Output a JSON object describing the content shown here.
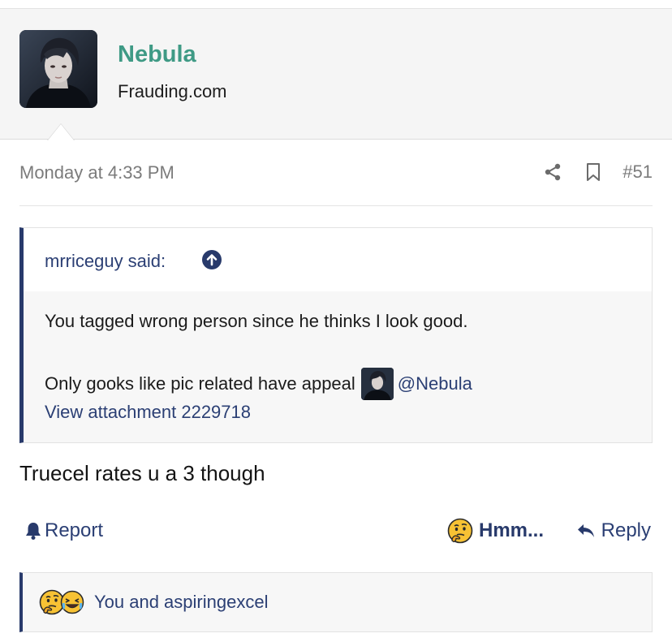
{
  "colors": {
    "username": "#3f9a85",
    "link": "#2b3f74",
    "accent_border": "#283a6b",
    "muted_text": "#7b7b7b",
    "header_bg": "#f5f5f5"
  },
  "user": {
    "name": "Nebula",
    "title": "Frauding.com",
    "avatar_icon": "user-avatar-photo"
  },
  "post": {
    "date": "Monday at 4:33 PM",
    "number": "#51",
    "share_icon": "share-icon",
    "bookmark_icon": "bookmark-icon",
    "text": "Truecel rates u a 3 though"
  },
  "quote": {
    "author": "mrriceguy said:",
    "jump_icon": "arrow-up-circle-icon",
    "line1": "You tagged wrong person since he thinks I look good.",
    "line2": "Only gooks like pic related have appeal",
    "mention": "@Nebula",
    "attachment_link": "View attachment 2229718"
  },
  "actions": {
    "report_label": "Report",
    "report_icon": "bell-icon",
    "reaction_label": "Hmm...",
    "reaction_icon": "thinking-face-icon",
    "reply_label": "Reply",
    "reply_icon": "reply-arrow-icon"
  },
  "reactions": {
    "icons": [
      "thinking-face-icon",
      "crying-laughing-face-icon"
    ],
    "summary": "You and aspiringexcel"
  }
}
